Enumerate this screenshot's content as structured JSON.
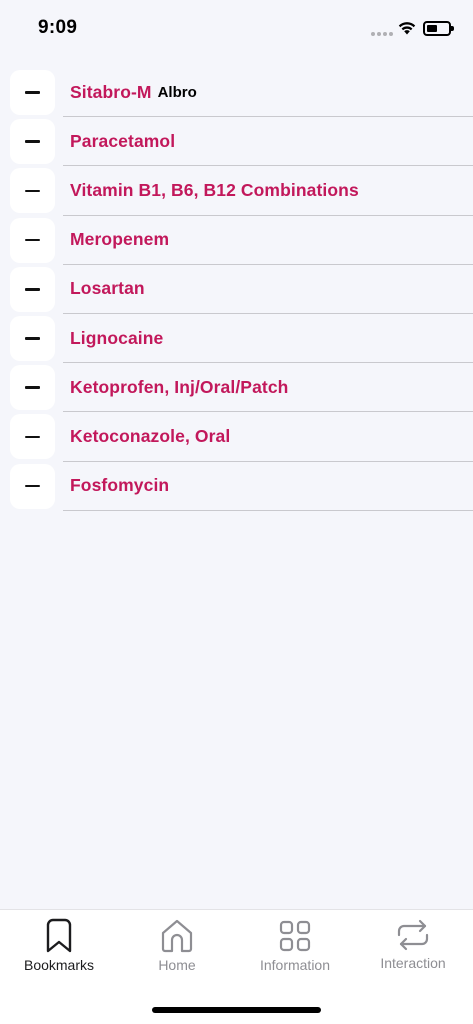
{
  "status_bar": {
    "time": "9:09",
    "icons": [
      "signal-dots-icon",
      "wifi-icon",
      "battery-icon"
    ]
  },
  "bookmarks": [
    {
      "name": "Sitabro-M",
      "brand": "Albro"
    },
    {
      "name": "Paracetamol",
      "brand": ""
    },
    {
      "name": "Vitamin B1, B6, B12 Combinations",
      "brand": ""
    },
    {
      "name": "Meropenem",
      "brand": ""
    },
    {
      "name": "Losartan",
      "brand": ""
    },
    {
      "name": "Lignocaine",
      "brand": ""
    },
    {
      "name": "Ketoprofen, Inj/Oral/Patch",
      "brand": ""
    },
    {
      "name": "Ketoconazole, Oral",
      "brand": ""
    },
    {
      "name": "Fosfomycin",
      "brand": ""
    }
  ],
  "tab_bar": {
    "tabs": [
      {
        "label": "Bookmarks",
        "icon": "bookmark-icon",
        "active": true
      },
      {
        "label": "Home",
        "icon": "home-icon",
        "active": false
      },
      {
        "label": "Information",
        "icon": "grid-icon",
        "active": false
      },
      {
        "label": "Interaction",
        "icon": "repeat-icon",
        "active": false
      }
    ]
  },
  "colors": {
    "accent": "#c2185b",
    "background": "#f5f6fb",
    "tab_active": "#1c1c1e",
    "tab_inactive": "#8e8e93"
  }
}
